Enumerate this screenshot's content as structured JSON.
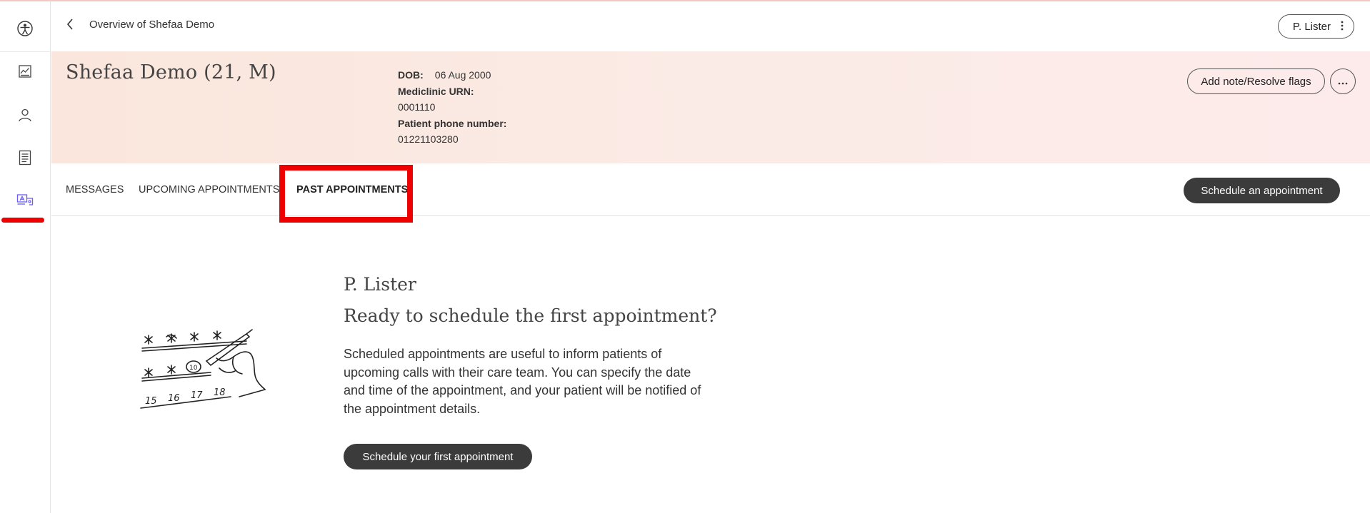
{
  "header": {
    "breadcrumb": "Overview of Shefaa Demo",
    "user_button_label": "P. Lister"
  },
  "sidebar": {
    "items": [
      {
        "name": "chart-icon"
      },
      {
        "name": "person-icon"
      },
      {
        "name": "document-icon"
      },
      {
        "name": "appointments-icon",
        "active": true
      }
    ]
  },
  "patient": {
    "name": "Shefaa Demo (21, M)",
    "dob_label": "DOB:",
    "dob_value": "06 Aug 2000",
    "urn_label": "Mediclinic URN:",
    "urn_value": "0001110",
    "phone_label": "Patient phone number:",
    "phone_value": "01221103280",
    "note_button": "Add note/Resolve flags",
    "more_button": "···"
  },
  "tabs": {
    "items": [
      "MESSAGES",
      "UPCOMING APPOINTMENTS",
      "PAST APPOINTMENTS"
    ],
    "active": "PAST APPOINTMENTS",
    "schedule_button": "Schedule an appointment"
  },
  "empty_state": {
    "user": "P. Lister",
    "title": "Ready to schedule the first appointment?",
    "body": "Scheduled appointments are useful to inform patients of upcoming calls with their care team. You can specify the date and time of the appointment, and your patient will be notified of the appointment details.",
    "button": "Schedule your first appointment",
    "illustration_numbers": [
      "15",
      "16",
      "17",
      "18"
    ]
  },
  "colors": {
    "accent": "#3b3b3b",
    "highlight": "#ee0000",
    "active_nav_icon": "#6b5cff",
    "patient_header_bg": "#fbe9e2"
  }
}
